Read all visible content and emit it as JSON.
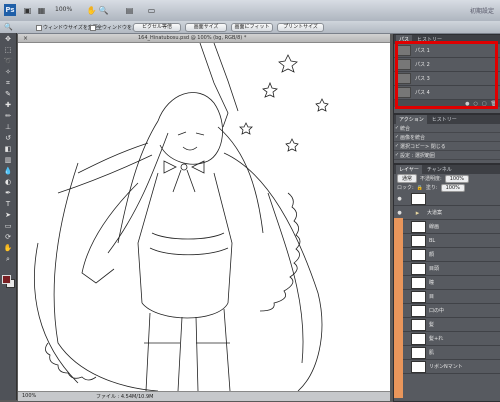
{
  "menubar": {
    "ps_label": "Ps",
    "zoom": "100%",
    "workspace": "初期設定"
  },
  "options": {
    "resize_windows": "ウィンドウサイズを変更",
    "all_windows_zoom": "全ウィンドウをズーム",
    "actual_pixels": "ピクセル等倍",
    "print_size": "画面サイズ",
    "fit_screen": "画面にフィット",
    "print_size2": "プリントサイズ"
  },
  "document": {
    "tab_title": "164_Hinatubosu.psd @ 100% (bg, RGB/8) *",
    "close": "×"
  },
  "status": {
    "zoom": "100%",
    "file_info": "ファイル : 4.54M/10.9M"
  },
  "paths_panel": {
    "tabs": [
      "パス",
      "ヒストリー"
    ],
    "items": [
      "パス 1",
      "パス 2",
      "パス 3",
      "パス 4"
    ]
  },
  "actions_panel": {
    "tabs": [
      "アクション",
      "ヒストリー"
    ],
    "items": [
      "統合",
      "画像を統合",
      "選択コピー> 閉じる",
      "設定 : 選択範囲"
    ]
  },
  "layers_panel": {
    "tabs": [
      "レイヤー",
      "チャンネル"
    ],
    "blend_mode": "通常",
    "opacity_label": "不透明度:",
    "opacity": "100%",
    "lock_label": "ロック:",
    "fill_label": "塗り:",
    "fill": "100%",
    "layers": [
      "",
      "大道案",
      "線画",
      "BL",
      "顔",
      "目頭",
      "瞳",
      "目",
      "口の中",
      "髪",
      "髪+れ",
      "肌",
      "リボンNマント"
    ]
  },
  "colors": {
    "highlight": "#e00000",
    "foreground": "#7a1e22",
    "layer_bar": "#e9965b"
  }
}
